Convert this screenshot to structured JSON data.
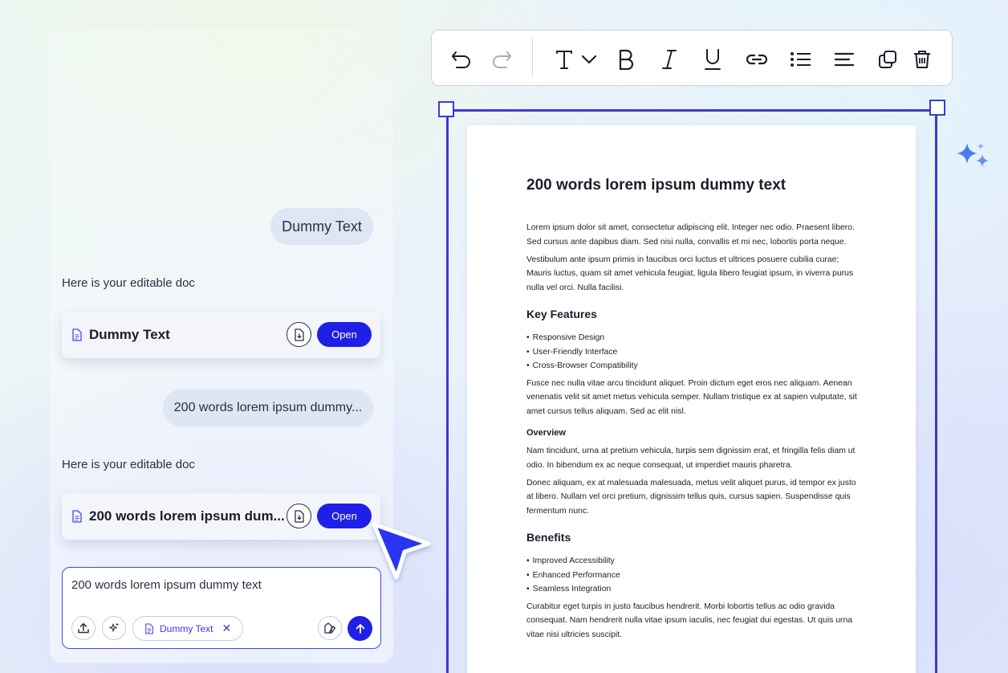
{
  "chat": {
    "user_message_1": "Dummy Text",
    "bot_label_1": "Here is your editable doc",
    "doc_card_1": {
      "title": "Dummy Text",
      "open_label": "Open"
    },
    "user_message_2": "200 words lorem ipsum dummy...",
    "bot_label_2": "Here is your editable doc",
    "doc_card_2": {
      "title": "200 words lorem ipsum dum...",
      "open_label": "Open"
    }
  },
  "composer": {
    "text": "200 words lorem ipsum dummy text",
    "chip_label": "Dummy Text",
    "chip_close": "✕"
  },
  "toolbar": {
    "buttons": [
      "undo-icon",
      "redo-icon",
      "text-style-icon",
      "chevron-down-icon",
      "bold-icon",
      "italic-icon",
      "underline-icon",
      "link-icon",
      "bullet-list-icon",
      "align-icon",
      "duplicate-icon",
      "delete-icon"
    ]
  },
  "document": {
    "title": "200 words lorem ipsum dummy text",
    "p1": "Lorem ipsum dolor sit amet, consectetur adipiscing elit. Integer nec odio. Praesent libero. Sed cursus ante dapibus diam. Sed nisi nulla, convallis et mi nec, lobortis porta neque.",
    "p2": "Vestibulum ante ipsum primis in faucibus orci luctus et ultrices posuere cubilia curae; Mauris luctus, quam sit amet vehicula feugiat, ligula libero feugiat ipsum, in viverra purus nulla vel orci. Nulla facilisi.",
    "h_key_features": "Key Features",
    "features": [
      "Responsive Design",
      "User-Friendly Interface",
      "Cross-Browser Compatibility"
    ],
    "p3": "Fusce nec nulla vitae arcu tincidunt aliquet. Proin dictum eget eros nec aliquam. Aenean venenatis velit sit amet metus vehicula semper. Nullam tristique ex at sapien vulputate, sit amet cursus tellus aliquam. Sed ac elit nisl.",
    "h_overview": "Overview",
    "p4": "Nam tincidunt, urna at pretium vehicula, turpis sem dignissim erat, et fringilla felis diam ut odio. In bibendum ex ac neque consequat, ut imperdiet mauris pharetra.",
    "p5": "Donec aliquam, ex at malesuada malesuada, metus velit aliquet purus, id tempor ex justo at libero. Nullam vel orci pretium, dignissim tellus quis, cursus sapien. Suspendisse quis fermentum nunc.",
    "h_benefits": "Benefits",
    "benefits": [
      "Improved Accessibility",
      "Enhanced Performance",
      "Seamless Integration"
    ],
    "p6": "Curabitur eget turpis in justo faucibus hendrerit. Morbi lobortis tellus ac odio gravida consequat. Nam hendrerit nulla vitae ipsum iaculis, nec feugiat dui egestas. Ut quis urna vitae nisi ultricies suscipit."
  },
  "colors": {
    "accent": "#1f1fe6",
    "frame": "#3a3ad8",
    "bubble": "#dde6f2",
    "sparkle": "#4b7bf0"
  }
}
